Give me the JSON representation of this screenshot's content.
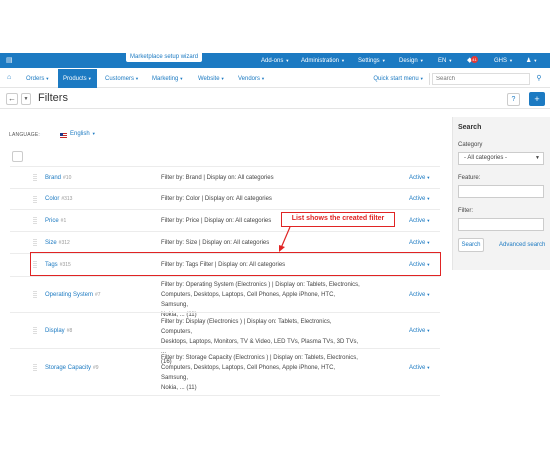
{
  "topbar": {
    "home_icon": "storefront-icon",
    "wizard": "Marketplace setup wizard",
    "items": [
      "Add-ons",
      "Administration",
      "Settings",
      "Design",
      "EN"
    ],
    "notif_count": "41",
    "currency": "GHS",
    "user_icon": "user-icon"
  },
  "nav": {
    "home_icon": "home-icon",
    "items": [
      "Orders",
      "Products",
      "Customers",
      "Marketing",
      "Website",
      "Vendors"
    ],
    "quick_start": "Quick start menu",
    "search_placeholder": "Search"
  },
  "title": {
    "text": "Filters"
  },
  "language": {
    "label": "LANGUAGE:",
    "value": "English"
  },
  "filters": [
    {
      "name": "Brand",
      "id": "#10",
      "desc": [
        "Filter by: Brand | Display on: All categories"
      ],
      "status": "Active"
    },
    {
      "name": "Color",
      "id": "#313",
      "desc": [
        "Filter by: Color | Display on: All categories"
      ],
      "status": "Active"
    },
    {
      "name": "Price",
      "id": "#1",
      "desc": [
        "Filter by: Price | Display on: All categories"
      ],
      "status": "Active"
    },
    {
      "name": "Size",
      "id": "#312",
      "desc": [
        "Filter by: Size | Display on: All categories"
      ],
      "status": "Active"
    },
    {
      "name": "Tags",
      "id": "#315",
      "desc": [
        "Filter by: Tags Filter | Display on: All categories"
      ],
      "status": "Active"
    },
    {
      "name": "Operating System",
      "id": "#7",
      "desc": [
        "Filter by: Operating System (Electronics ) | Display on: Tablets, Electronics,",
        "Computers, Desktops, Laptops, Cell Phones, Apple iPhone, HTC, Samsung,",
        "Nokia, ... (11)"
      ],
      "status": "Active"
    },
    {
      "name": "Display",
      "id": "#8",
      "desc": [
        "Filter by: Display (Electronics ) | Display on: Tablets, Electronics, Computers,",
        "Desktops, Laptops, Monitors, TV & Video, LED TVs, Plasma TVs, 3D TVs, ...",
        "(16)"
      ],
      "status": "Active"
    },
    {
      "name": "Storage Capacity",
      "id": "#9",
      "desc": [
        "Filter by: Storage Capacity (Electronics ) | Display on: Tablets, Electronics,",
        "Computers, Desktops, Laptops, Cell Phones, Apple iPhone, HTC, Samsung,",
        "Nokia, ... (11)"
      ],
      "status": "Active"
    }
  ],
  "callout": "List shows the created filter",
  "sidebar": {
    "title": "Search",
    "category_label": "Category",
    "category_value": "- All categories -",
    "feature_label": "Feature:",
    "filter_label": "Filter:",
    "search_button": "Search",
    "advanced_link": "Advanced search"
  },
  "colors": {
    "accent": "#1c7ac2",
    "highlight": "#e02424"
  }
}
